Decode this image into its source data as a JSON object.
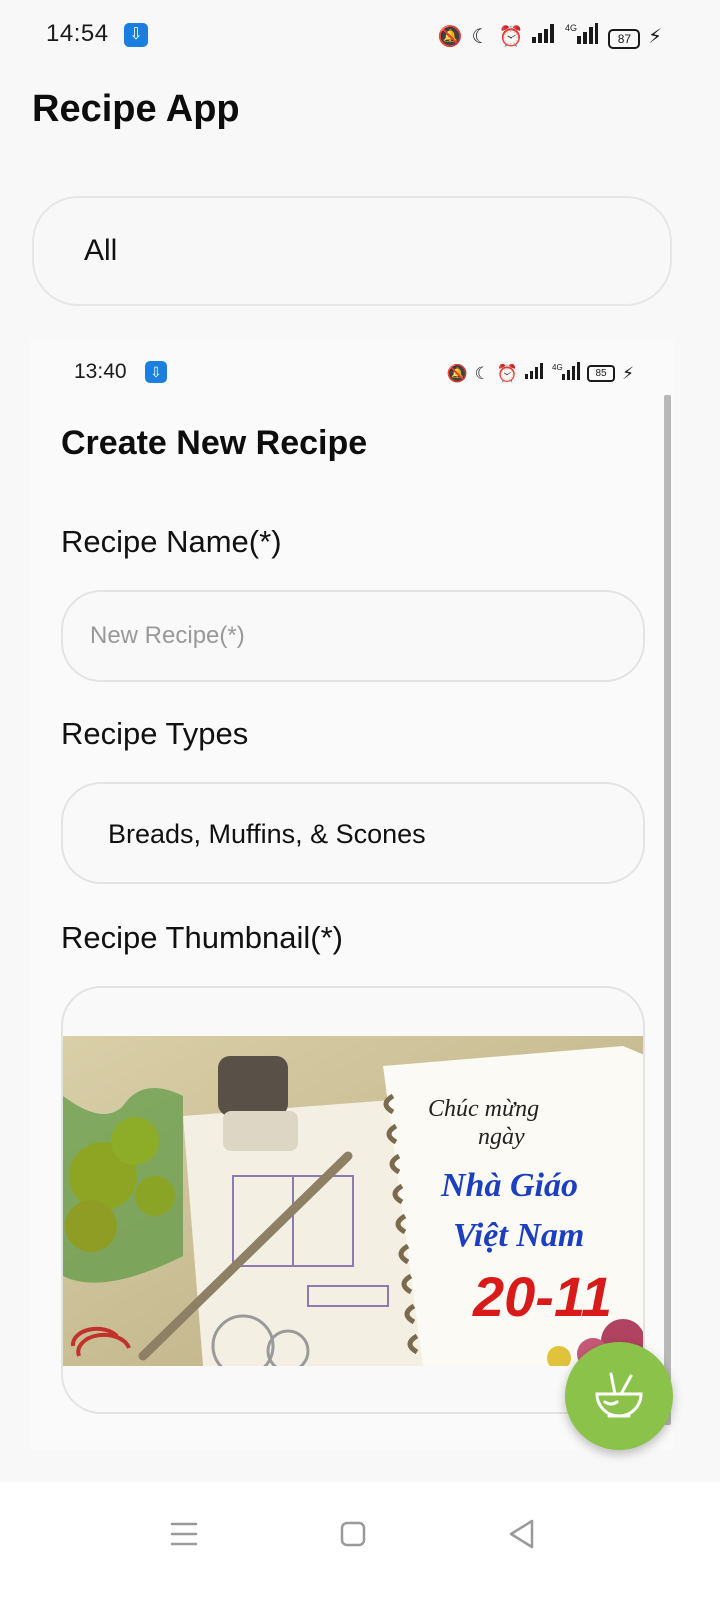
{
  "status_bar": {
    "time": "14:54",
    "battery": "87",
    "icons": [
      "usb-icon",
      "mute-icon",
      "moon-icon",
      "alarm-icon",
      "signal-icon",
      "4g-signal-icon",
      "battery-icon",
      "charging-icon"
    ]
  },
  "app": {
    "title": "Recipe App"
  },
  "filter": {
    "selected": "All"
  },
  "preview": {
    "status_time": "13:40",
    "status_battery": "85",
    "form_title": "Create New Recipe",
    "name_label": "Recipe Name(*)",
    "name_placeholder": "New Recipe(*)",
    "types_label": "Recipe Types",
    "types_value": "Breads, Muffins, & Scones",
    "thumbnail_label": "Recipe Thumbnail(*)",
    "thumbnail": {
      "line1": "Chúc mừng",
      "line2": "ngày",
      "line3": "Nhà Giáo",
      "line4": "Việt Nam",
      "line5": "20-11"
    }
  },
  "fab": {
    "icon": "bowl-icon",
    "color": "#8bc34a"
  },
  "nav": {
    "icons": [
      "menu-icon",
      "home-icon",
      "back-icon"
    ]
  },
  "colors": {
    "accent": "#8bc34a",
    "usb_badge": "#1b7fe0"
  }
}
